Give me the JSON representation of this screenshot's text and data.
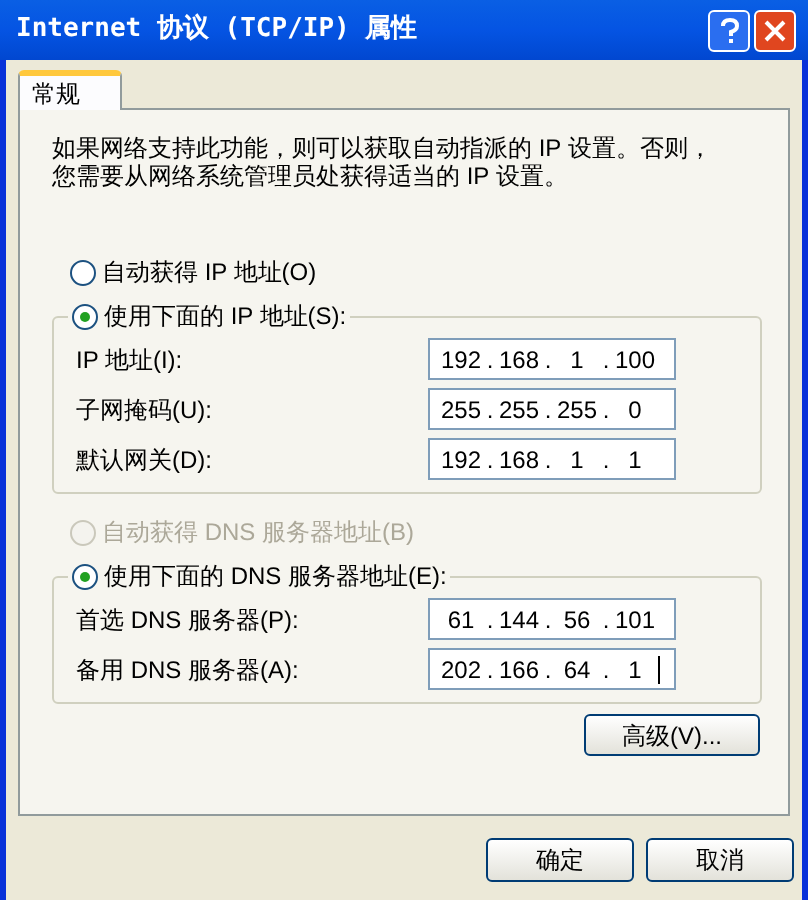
{
  "window": {
    "title": "Internet 协议 (TCP/IP) 属性"
  },
  "tabs": [
    {
      "label": "常规",
      "selected": true
    }
  ],
  "description": [
    "如果网络支持此功能，则可以获取自动指派的 IP 设置。否则，",
    "您需要从网络系统管理员处获得适当的 IP 设置。"
  ],
  "octet_separator": ".",
  "ip_mode": [
    {
      "label": "自动获得 IP 地址(O)",
      "selected": false,
      "disabled": false
    },
    {
      "label": "使用下面的 IP 地址(S):",
      "selected": true,
      "disabled": false
    }
  ],
  "ip_fields": [
    {
      "label": "IP 地址(I):",
      "octets": [
        "192",
        "168",
        "1",
        "100"
      ],
      "focused": false
    },
    {
      "label": "子网掩码(U):",
      "octets": [
        "255",
        "255",
        "255",
        "0"
      ],
      "focused": false
    },
    {
      "label": "默认网关(D):",
      "octets": [
        "192",
        "168",
        "1",
        "1"
      ],
      "focused": false
    }
  ],
  "dns_mode": [
    {
      "label": "自动获得 DNS 服务器地址(B)",
      "selected": false,
      "disabled": true
    },
    {
      "label": "使用下面的 DNS 服务器地址(E):",
      "selected": true,
      "disabled": false
    }
  ],
  "dns_fields": [
    {
      "label": "首选 DNS 服务器(P):",
      "octets": [
        "61",
        "144",
        "56",
        "101"
      ],
      "focused": false
    },
    {
      "label": "备用 DNS 服务器(A):",
      "octets": [
        "202",
        "166",
        "64",
        "1"
      ],
      "focused": true
    }
  ],
  "advanced_button": "高级(V)...",
  "buttons": [
    "确定",
    "取消"
  ]
}
